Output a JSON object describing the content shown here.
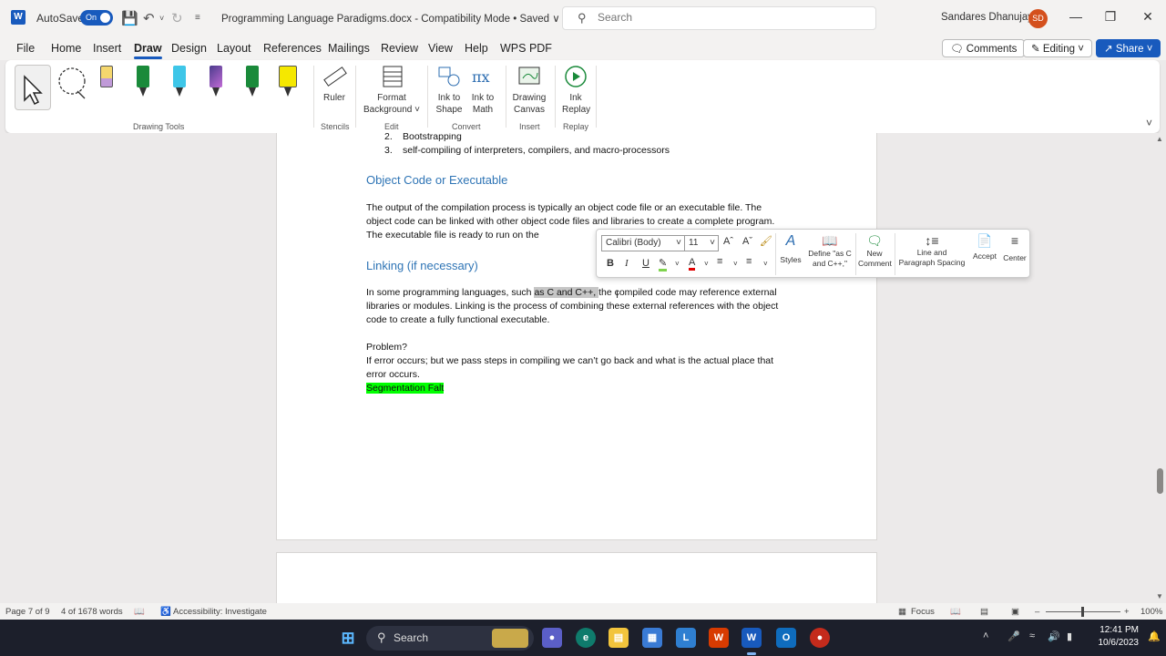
{
  "titlebar": {
    "app_icon": "word-icon",
    "app_letter": "W",
    "autosave_label": "AutoSave",
    "autosave_state": "On",
    "doc_title": "Programming Language Paradigms.docx  -  Compatibility Mode • Saved ∨",
    "search_placeholder": "Search",
    "user_name": "Sandares Dhanujaya",
    "avatar_initials": "SD",
    "accent_color": "#185abd"
  },
  "menu": {
    "tabs": [
      "File",
      "Home",
      "Insert",
      "Draw",
      "Design",
      "Layout",
      "References",
      "Mailings",
      "Review",
      "View",
      "Help",
      "WPS PDF"
    ],
    "active_tab": "Draw",
    "comments_label": "Comments",
    "editing_label": "Editing ˅",
    "share_label": "Share ˅"
  },
  "ribbon": {
    "ruler": "Ruler",
    "format_bg_1": "Format",
    "format_bg_2": "Background ˅",
    "ink_shape_1": "Ink to",
    "ink_shape_2": "Shape",
    "ink_math_1": "Ink to",
    "ink_math_2": "Math",
    "canvas_1": "Drawing",
    "canvas_2": "Canvas",
    "replay_1": "Ink",
    "replay_2": "Replay",
    "groups": {
      "drawing_tools": "Drawing Tools",
      "stencils": "Stencils",
      "edit": "Edit",
      "convert": "Convert",
      "insert": "Insert",
      "replay": "Replay"
    },
    "pen_colors": [
      "#f5d76e",
      "#1a8a3a",
      "#3ec6e8",
      "#4b3b8c",
      "#1a8a3a",
      "#f5e800"
    ]
  },
  "document": {
    "list": [
      {
        "num": "2.",
        "text": "Bootstrapping"
      },
      {
        "num": "3.",
        "text": "self-compiling of interpreters, compilers, and macro-processors"
      }
    ],
    "heading1": "Object Code or Executable",
    "para1": "The output of the compilation process is typically an object code file or an executable file. The object code can be linked with other object code files and libraries to create a complete program. The executable file is ready to run on the",
    "heading2": "Linking (if necessary)",
    "para2_pre": "In some programming languages, such ",
    "para2_sel": "as C and C++, ",
    "para2_post": "the compiled code may reference external libraries or modules. Linking is the process of combining these external references with the object code to create a fully functional executable.",
    "problem": "Problem?",
    "problem_text": "If error occurs; but we pass steps in compiling we can’t go back and what is the actual place that error occurs.",
    "highlight": "Segmentation Falt",
    "highlight_color": "#00ff00"
  },
  "minitoolbar": {
    "font": "Calibri (Body)",
    "size": "11",
    "styles": "Styles",
    "define_1": "Define \"as C",
    "define_2": "and C++,\"",
    "new_comment_1": "New",
    "new_comment_2": "Comment",
    "spacing_1": "Line and",
    "spacing_2": "Paragraph Spacing",
    "accept": "Accept",
    "center": "Center"
  },
  "statusbar": {
    "page": "Page 7 of 9",
    "words": "4 of 1678 words",
    "accessibility": "Accessibility: Investigate",
    "focus": "Focus",
    "zoom": "100%"
  },
  "taskbar": {
    "search": "Search",
    "time": "12:41 PM",
    "date": "10/6/2023"
  }
}
